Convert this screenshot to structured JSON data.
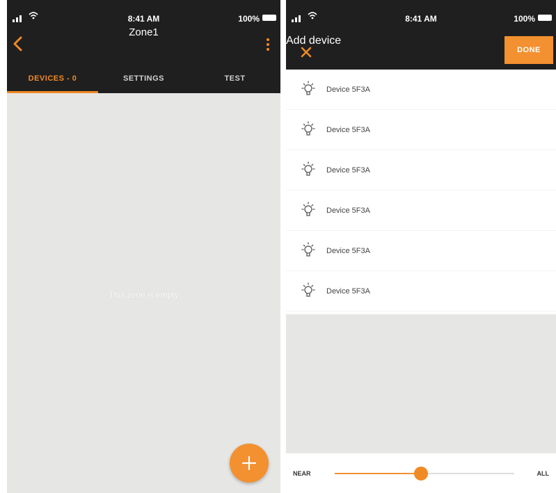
{
  "left": {
    "status": {
      "time": "8:41 AM",
      "battery": "100%"
    },
    "title": "Zone1",
    "tabs": [
      {
        "label": "DEVICES - 0",
        "active": true
      },
      {
        "label": "SETTINGS",
        "active": false
      },
      {
        "label": "TEST",
        "active": false
      }
    ],
    "empty_message": "This zone is empty",
    "fab_icon": "plus-icon"
  },
  "right": {
    "status": {
      "time": "8:41 AM",
      "battery": "100%"
    },
    "title": "Add device",
    "done_label": "DONE",
    "devices": [
      {
        "name": "Device 5F3A"
      },
      {
        "name": "Device 5F3A"
      },
      {
        "name": "Device 5F3A"
      },
      {
        "name": "Device 5F3A"
      },
      {
        "name": "Device 5F3A"
      },
      {
        "name": "Device 5F3A"
      }
    ],
    "range": {
      "min_label": "NEAR",
      "max_label": "ALL",
      "value": 0.48
    }
  },
  "colors": {
    "accent": "#f08a24",
    "bar": "#1f1f1f",
    "background": "#e6e6e5"
  }
}
